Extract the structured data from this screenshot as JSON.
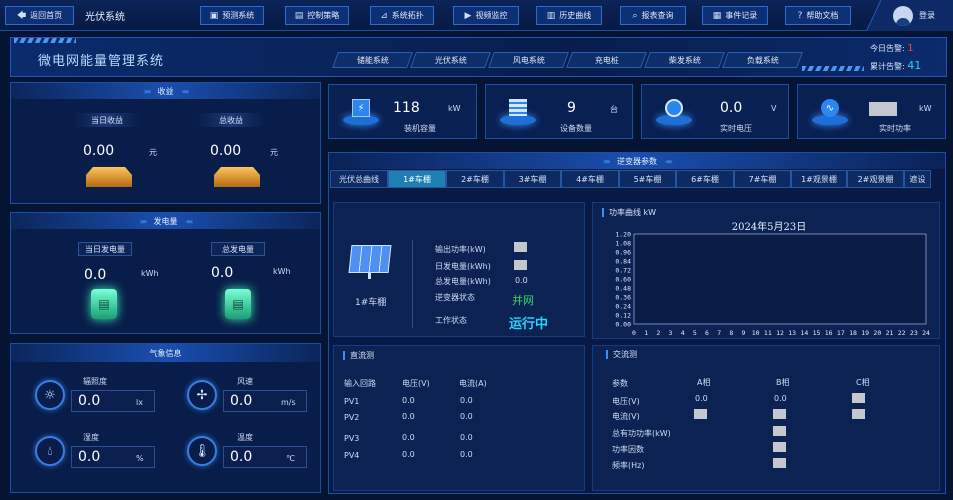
{
  "nav": {
    "back_label": "返回首页",
    "app_title": "光伏系统",
    "menu": [
      "预测系统",
      "控制策略",
      "系统拓扑",
      "视频监控",
      "历史曲线",
      "报表查询",
      "事件记录",
      "帮助文档"
    ],
    "login_label": "登录"
  },
  "header": {
    "title": "微电网能量管理系统",
    "alarms": {
      "today_label": "今日告警:",
      "today_value": "1",
      "total_label": "累计告警:",
      "total_value": "41"
    },
    "subsystem_tabs": [
      "储能系统",
      "光伏系统",
      "风电系统",
      "充电桩",
      "柴发系统",
      "负载系统"
    ]
  },
  "income": {
    "title": "收益",
    "today_label": "当日收益",
    "total_label": "总收益",
    "today_value": "0.00",
    "total_value": "0.00",
    "unit": "元"
  },
  "generation": {
    "title": "发电量",
    "today_label": "当日发电量",
    "total_label": "总发电量",
    "today_value": "0.0",
    "total_value": "0.0",
    "unit": "kWh"
  },
  "weather": {
    "title": "气象信息",
    "items": [
      {
        "label": "辐照度",
        "value": "0.0",
        "unit": "lx",
        "icon": "sun-icon"
      },
      {
        "label": "风速",
        "value": "0.0",
        "unit": "m/s",
        "icon": "fan-icon"
      },
      {
        "label": "湿度",
        "value": "0.0",
        "unit": "%",
        "icon": "droplet-icon"
      },
      {
        "label": "温度",
        "value": "0.0",
        "unit": "℃",
        "icon": "thermometer-icon"
      }
    ]
  },
  "stats": [
    {
      "value": "118",
      "unit": "kW",
      "label": "装机容量",
      "icon": "lightning-icon"
    },
    {
      "value": "9",
      "unit": "台",
      "label": "设备数量",
      "icon": "device-icon"
    },
    {
      "value": "0.0",
      "unit": "V",
      "label": "实时电压",
      "icon": "gauge-icon"
    },
    {
      "value": "",
      "unit": "kW",
      "label": "实时功率",
      "icon": "pulse-icon"
    }
  ],
  "inverter": {
    "title": "逆变器参数",
    "tabs": [
      "光伏总曲线",
      "1#车棚",
      "2#车棚",
      "3#车棚",
      "4#车棚",
      "5#车棚",
      "6#车棚",
      "7#车棚",
      "1#观景棚",
      "2#观景棚",
      "遮设"
    ],
    "active_tab": 1,
    "device_name": "1#车棚",
    "fields": {
      "output_power_label": "输出功率(kW)",
      "daily_gen_label": "日发电量(kWh)",
      "total_gen_label": "总发电量(kWh)",
      "total_gen_value": "0.0",
      "status_label": "逆变器状态",
      "status_value": "并网",
      "work_label": "工作状态",
      "work_value": "运行中"
    }
  },
  "power_chart": {
    "section_title": "功率曲线  kW",
    "chart_data": {
      "type": "line",
      "title": "2024年5月23日",
      "x": [
        0,
        1,
        2,
        3,
        4,
        5,
        6,
        7,
        8,
        9,
        10,
        11,
        12,
        13,
        14,
        15,
        16,
        17,
        18,
        19,
        20,
        21,
        22,
        23,
        24
      ],
      "y_ticks": [
        "1.20",
        "1.08",
        "0.96",
        "0.84",
        "0.72",
        "0.60",
        "0.48",
        "0.36",
        "0.24",
        "0.12",
        "0.00"
      ],
      "ylim": [
        0,
        1.2
      ],
      "series": [],
      "grid": false
    }
  },
  "dc": {
    "title": "直流测",
    "headers": [
      "输入回路",
      "电压(V)",
      "电流(A)"
    ],
    "rows": [
      [
        "PV1",
        "0.0",
        "0.0"
      ],
      [
        "PV2",
        "0.0",
        "0.0"
      ],
      [
        "PV3",
        "0.0",
        "0.0"
      ],
      [
        "PV4",
        "0.0",
        "0.0"
      ]
    ]
  },
  "ac": {
    "title": "交流测",
    "headers": [
      "参数",
      "A相",
      "B相",
      "C相"
    ],
    "rows": [
      "电压(V)",
      "电流(V)",
      "总有功功率(kW)",
      "功率因数",
      "频率(Hz)"
    ],
    "voltage_a": "0.0",
    "voltage_b": "0.0"
  },
  "colors": {
    "background": "#061433",
    "accent": "#3a8ef5",
    "green": "#2bdc6c",
    "alarm_red": "#ff3b3b",
    "alarm_cyan": "#27d3ff"
  }
}
